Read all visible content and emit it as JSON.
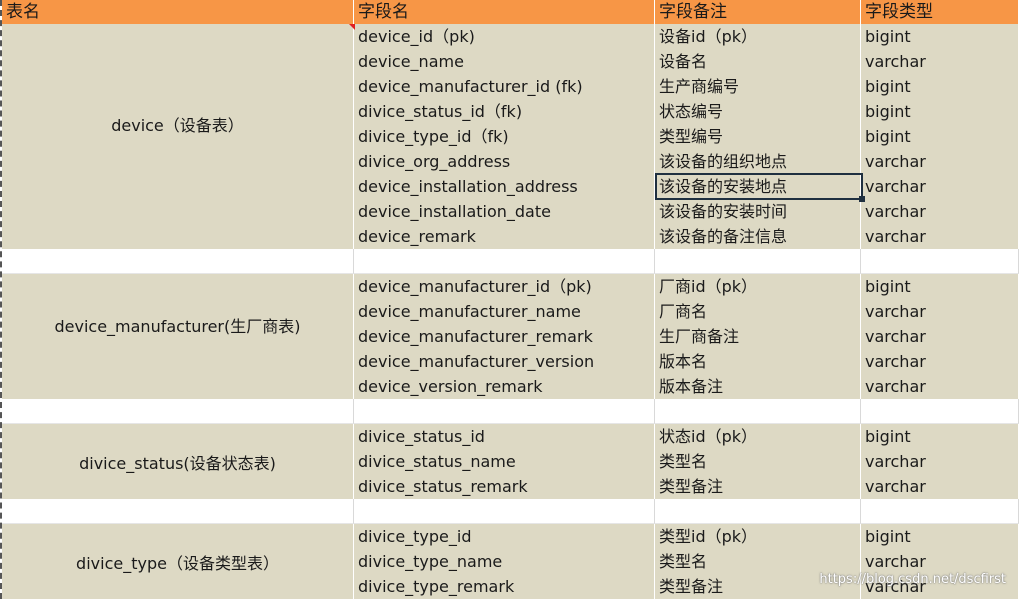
{
  "headers": [
    "表名",
    "字段名",
    "字段备注",
    "字段类型"
  ],
  "tables": [
    {
      "name": "device（设备表）",
      "rows": [
        [
          "device_id（pk)",
          "设备id（pk）",
          "bigint"
        ],
        [
          "device_name",
          "设备名",
          "varchar"
        ],
        [
          "device_manufacturer_id (fk)",
          "生产商编号",
          "bigint"
        ],
        [
          "divice_status_id（fk)",
          "状态编号",
          "bigint"
        ],
        [
          "divice_type_id（fk)",
          "类型编号",
          "bigint"
        ],
        [
          "divice_org_address",
          "该设备的组织地点",
          "varchar"
        ],
        [
          "device_installation_address",
          "该设备的安装地点",
          "varchar"
        ],
        [
          "device_installation_date",
          "该设备的安装时间",
          "varchar"
        ],
        [
          "device_remark",
          "该设备的备注信息",
          "varchar"
        ]
      ]
    },
    {
      "name": "device_manufacturer(生厂商表)",
      "rows": [
        [
          "device_manufacturer_id（pk)",
          "厂商id（pk）",
          "bigint"
        ],
        [
          "device_manufacturer_name",
          "厂商名",
          "varchar"
        ],
        [
          "device_manufacturer_remark",
          "生厂商备注",
          "varchar"
        ],
        [
          "device_manufacturer_version",
          "版本名",
          "varchar"
        ],
        [
          "device_version_remark",
          "版本备注",
          "varchar"
        ]
      ]
    },
    {
      "name": "divice_status(设备状态表)",
      "rows": [
        [
          "divice_status_id",
          "状态id（pk）",
          "bigint"
        ],
        [
          "divice_status_name",
          "类型名",
          "varchar"
        ],
        [
          "divice_status_remark",
          "类型备注",
          "varchar"
        ]
      ]
    },
    {
      "name": "divice_type（设备类型表）",
      "rows": [
        [
          "divice_type_id",
          "类型id（pk）",
          "bigint"
        ],
        [
          "divice_type_name",
          "类型名",
          "varchar"
        ],
        [
          "divice_type_remark",
          "类型备注",
          "varchar"
        ]
      ]
    }
  ],
  "watermark": "https://blog.csdn.net/dscfirst",
  "colors": {
    "header_bg": "#f79646",
    "row_bg": "#ddd9c4",
    "selection_border": "#1f3040",
    "comment_marker": "#e02020"
  }
}
